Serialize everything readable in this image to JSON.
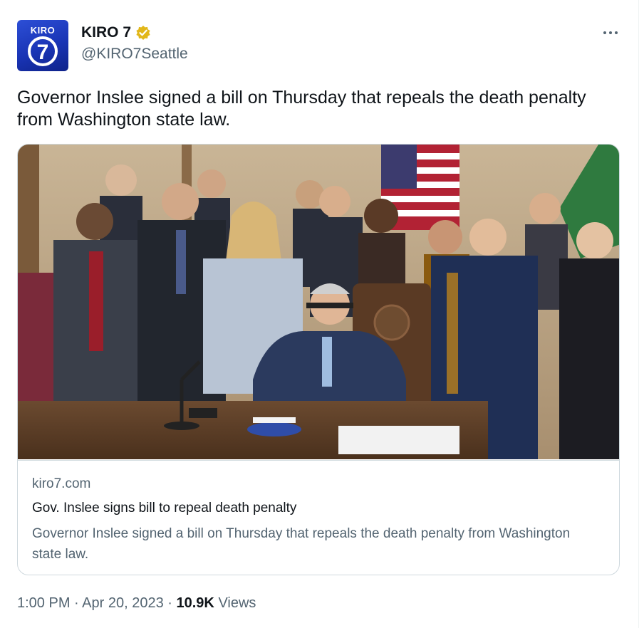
{
  "account": {
    "avatar_brand": "KIRO",
    "avatar_number": "7",
    "display_name": "KIRO 7",
    "handle": "@KIRO7Seattle",
    "verified_icon": "gold-verified-badge-icon"
  },
  "tweet": {
    "text": "Governor Inslee signed a bill on Thursday that repeals the death penalty from Washington state law."
  },
  "card": {
    "image_description_icon": "photo",
    "domain": "kiro7.com",
    "title": "Gov. Inslee signs bill to repeal death penalty",
    "description": "Governor Inslee signed a bill on Thursday that repeals the death penalty from Washington state law."
  },
  "footer": {
    "time": "1:00 PM",
    "separator": "·",
    "date": "Apr 20, 2023",
    "views_count": "10.9K",
    "views_label": "Views"
  },
  "colors": {
    "text_primary": "#0f1419",
    "text_secondary": "#536471",
    "border": "#cfd9de",
    "verified_gold": "#e2b719",
    "avatar_blue": "#1934b5"
  }
}
